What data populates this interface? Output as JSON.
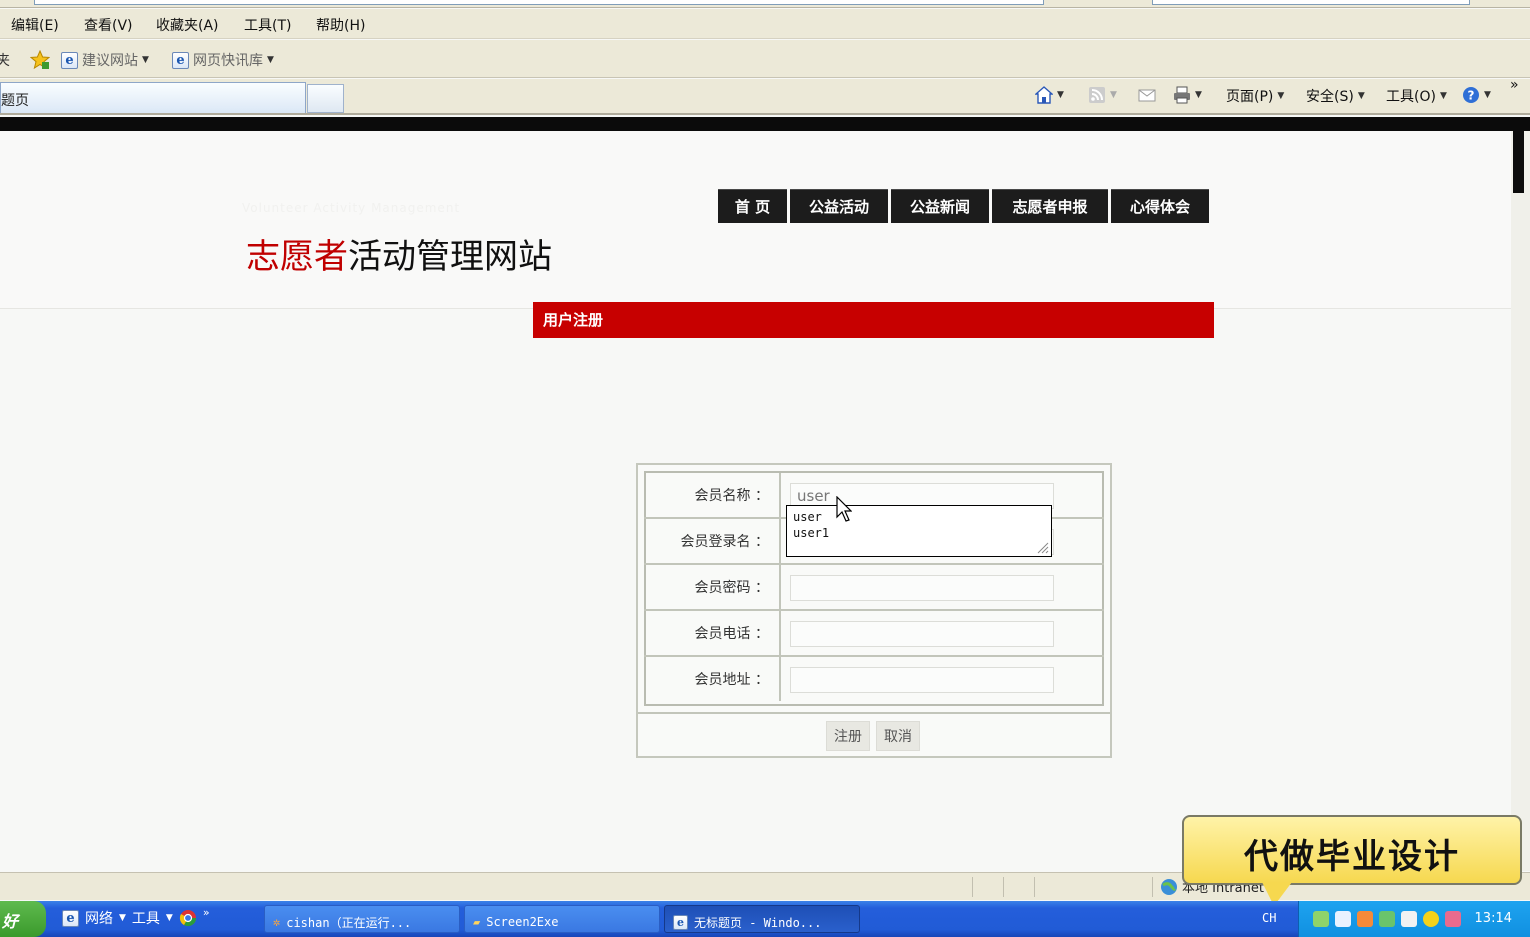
{
  "menubar": {
    "items": [
      "编辑(E)",
      "查看(V)",
      "收藏夹(A)",
      "工具(T)",
      "帮助(H)"
    ]
  },
  "linksbar": {
    "left_fragment": "夹",
    "suggested_sites": "建议网站",
    "web_slices": "网页快讯库"
  },
  "tabbar": {
    "active_tab": "题页",
    "page_menu": "页面(P)",
    "safety_menu": "安全(S)",
    "tools_menu": "工具(O)",
    "more": "»"
  },
  "site": {
    "subtitle": "Volunteer Activity Management",
    "title_red": "志愿者",
    "title_rest": "活动管理网站"
  },
  "nav": {
    "items": [
      "首 页",
      "公益活动",
      "公益新闻",
      "志愿者申报",
      "心得体会"
    ]
  },
  "register": {
    "section_title": "用户注册",
    "fields": [
      {
        "label": "会员名称 ：",
        "value": "user"
      },
      {
        "label": "会员登录名 ：",
        "value": ""
      },
      {
        "label": "会员密码 ：",
        "value": ""
      },
      {
        "label": "会员电话 ：",
        "value": ""
      },
      {
        "label": "会员地址 ：",
        "value": ""
      }
    ],
    "autocomplete": [
      "user",
      "user1"
    ],
    "submit_label": "注册",
    "cancel_label": "取消"
  },
  "statusbar": {
    "zone": "本地 Intranet"
  },
  "promo": {
    "text": "代做毕业设计"
  },
  "taskbar": {
    "start_label": "好",
    "quick": {
      "network": "网络",
      "tools": "工具",
      "more": "»"
    },
    "tasks": [
      {
        "label": "cishan（正在运行..."
      },
      {
        "label": "Screen2Exe"
      },
      {
        "label": "无标题页 - Windo..."
      }
    ],
    "lang": "CH",
    "clock": "13:14"
  },
  "colors": {
    "accent_red": "#c70000",
    "nav_bg": "#1c1c1c",
    "taskbar_blue": "#245edb"
  }
}
